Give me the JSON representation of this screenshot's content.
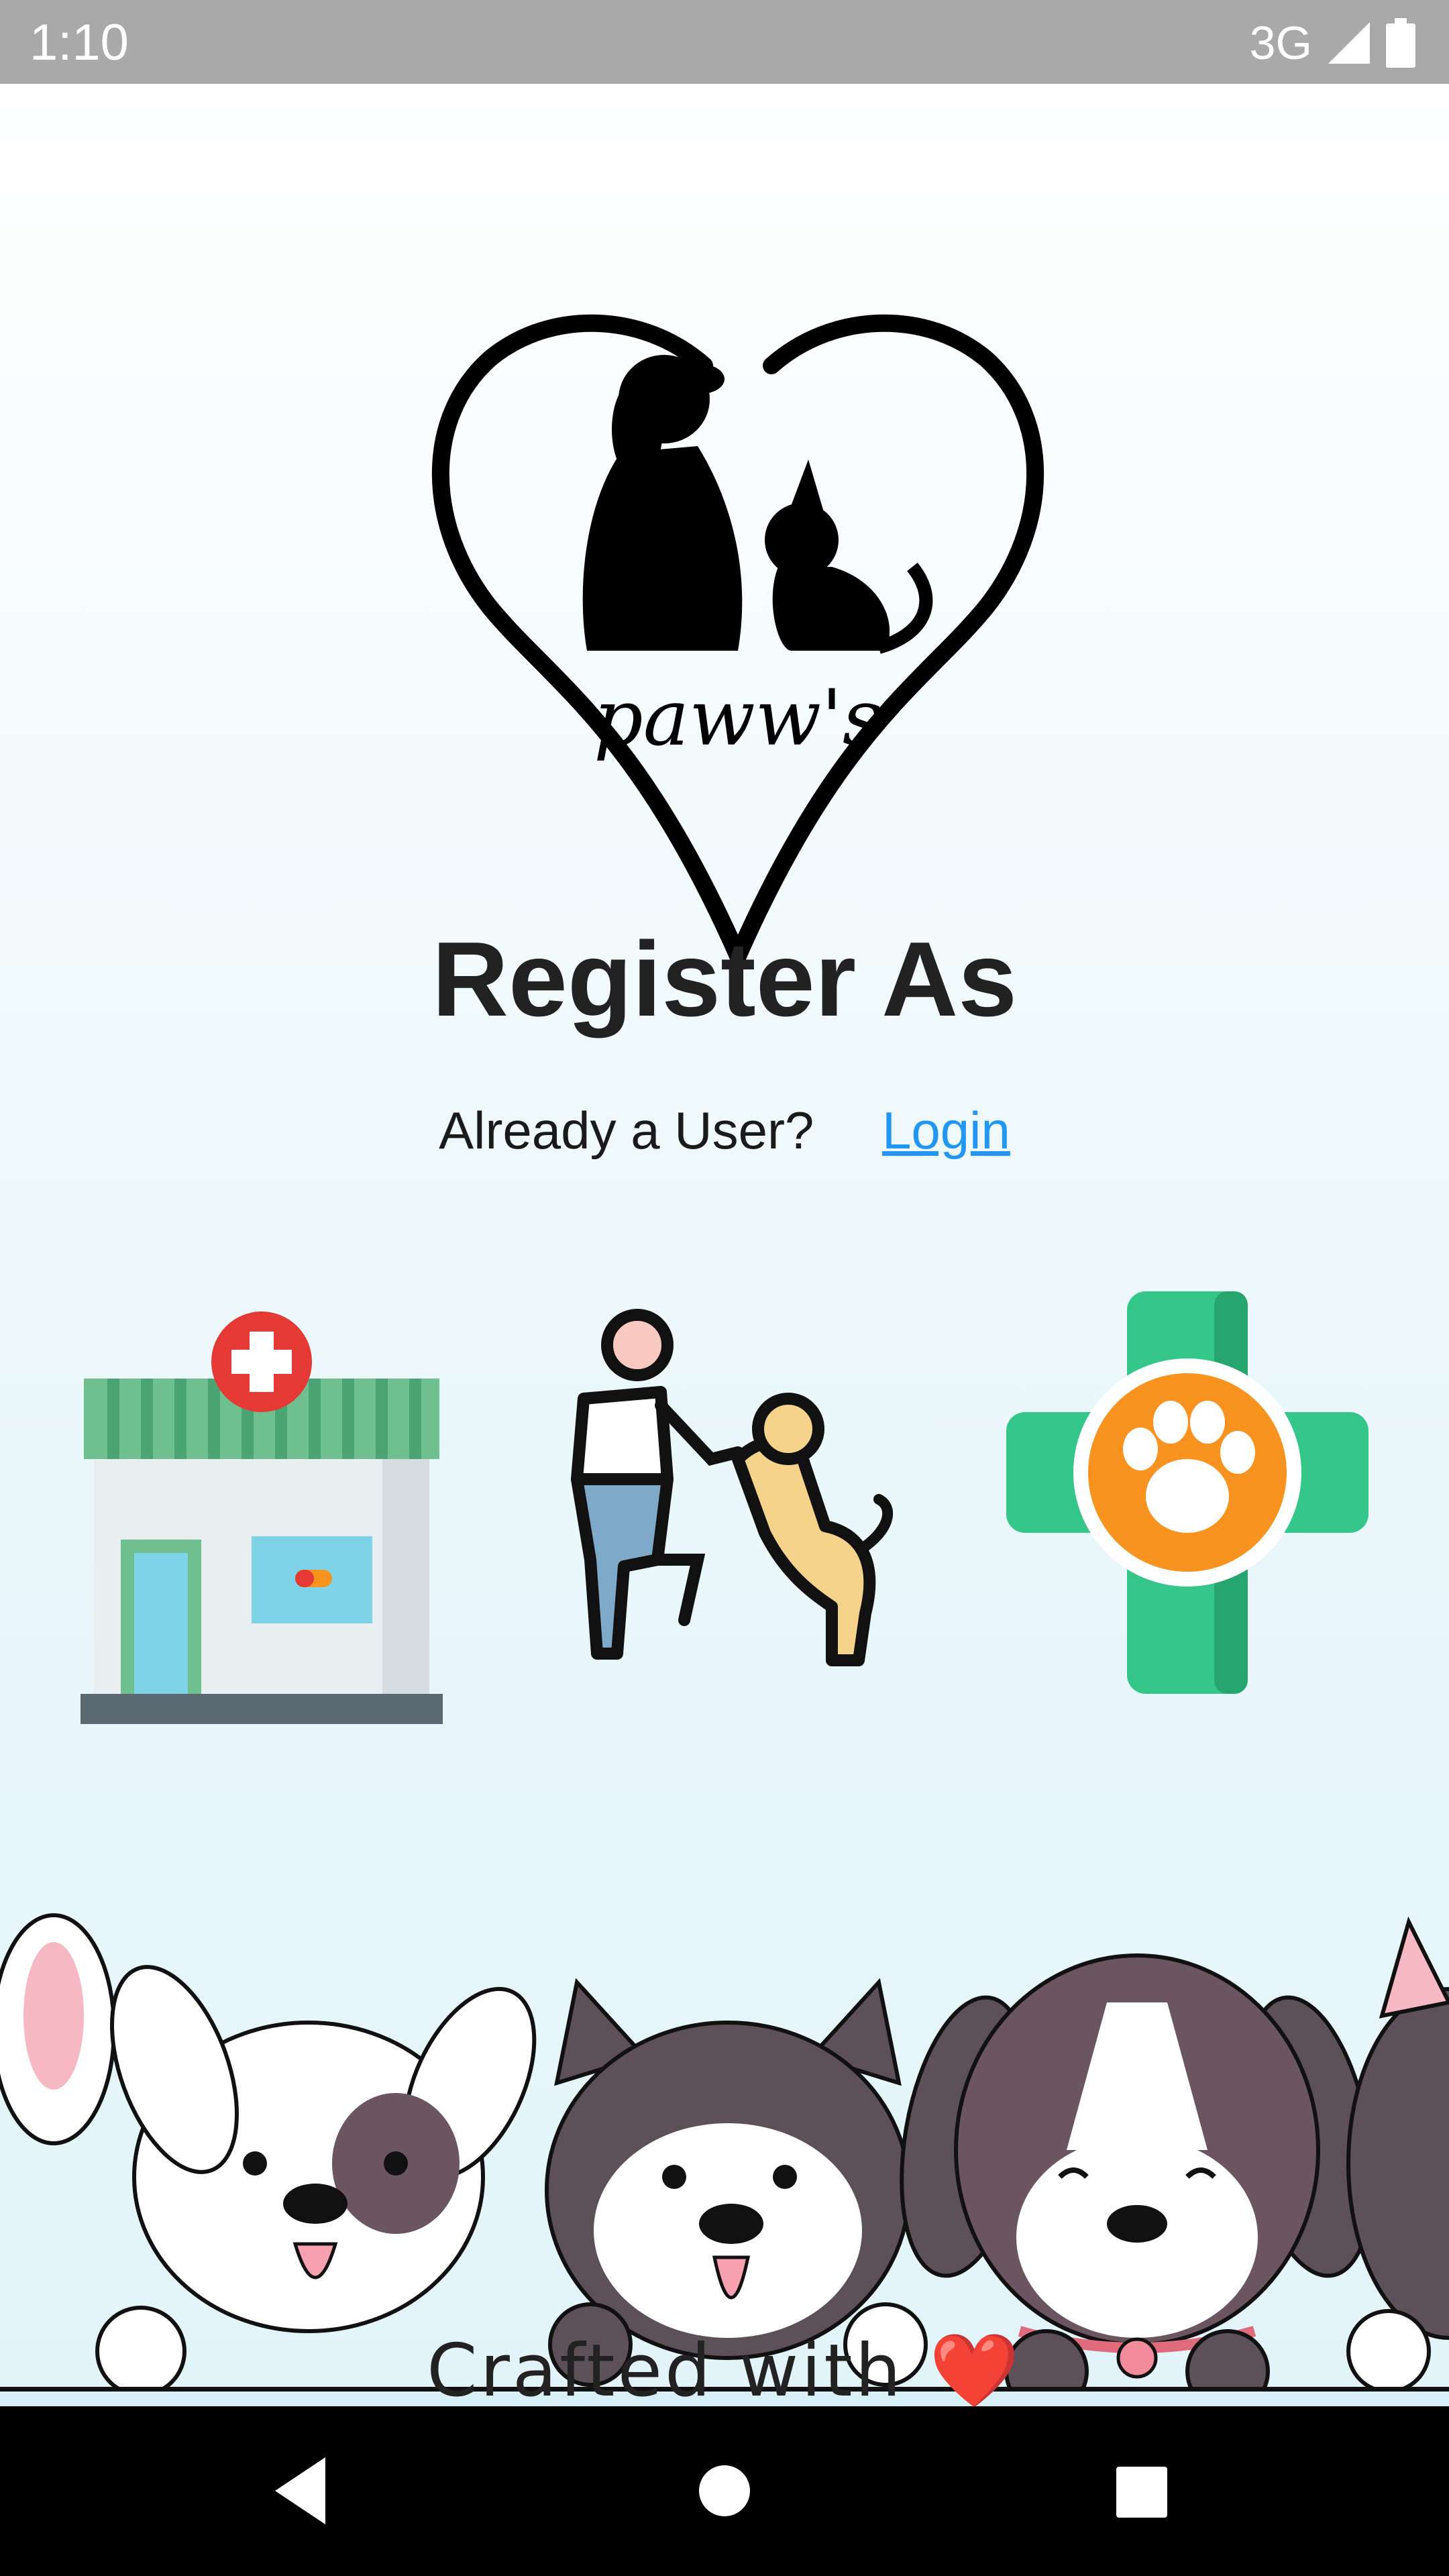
{
  "status_bar": {
    "time": "1:10",
    "network": "3G",
    "icons": [
      "signal-icon",
      "battery-icon"
    ]
  },
  "logo": {
    "text": "paww's",
    "icon": "heart-pets-logo"
  },
  "title": "Register As",
  "login": {
    "prompt": "Already a User?",
    "link": "Login"
  },
  "roles": [
    {
      "icon": "clinic-building-icon"
    },
    {
      "icon": "person-playing-with-dog-icon"
    },
    {
      "icon": "vet-cross-paw-icon"
    }
  ],
  "footer": {
    "text": "Crafted with",
    "emoji": "❤️"
  },
  "nav_bar": {
    "icons": [
      "back-icon",
      "home-icon",
      "recents-icon"
    ]
  },
  "colors": {
    "status_bar": "#a9a9a9",
    "link": "#2196f3",
    "clinic_green": "#6fbf8f",
    "vet_green": "#34c789",
    "paw_orange": "#f7931e",
    "heart_red": "#e53935"
  }
}
